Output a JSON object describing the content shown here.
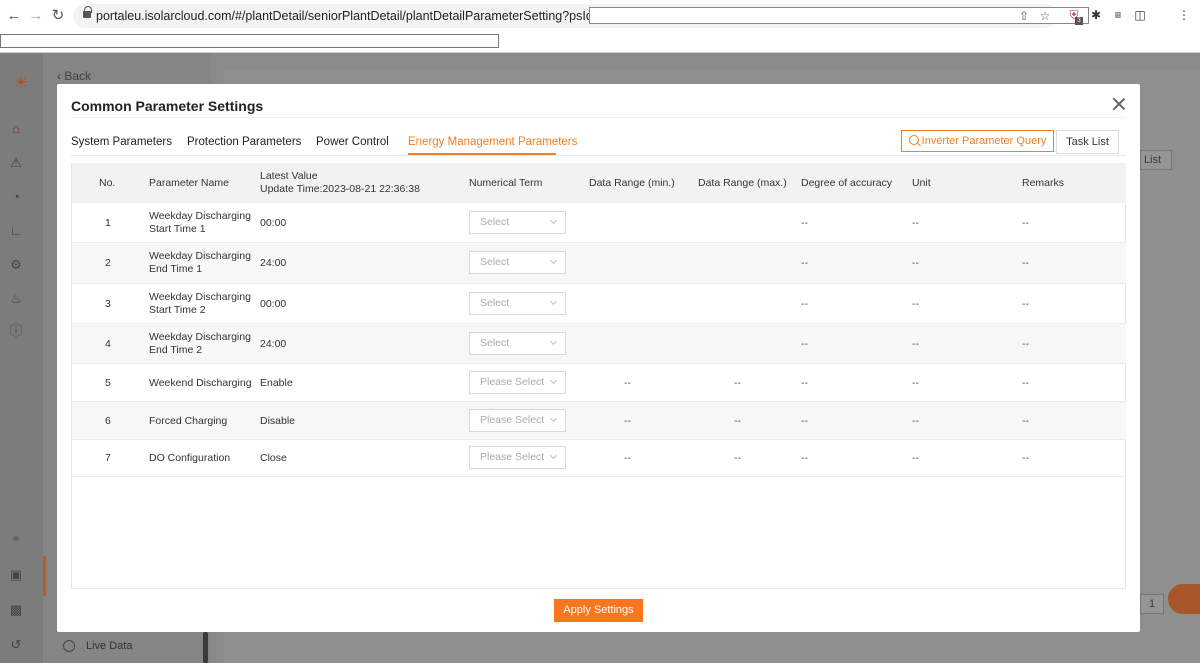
{
  "browser": {
    "url": "portaleu.isolarcloud.com/#/plantDetail/seniorPlantDetail/plantDetailParameterSetting?psId=",
    "ext_badge": "3"
  },
  "app": {
    "back_label": "Back",
    "live_data_label": "Live Data",
    "bg_list_label": "List",
    "bg_page_number": "1"
  },
  "modal": {
    "title": "Common Parameter Settings",
    "tabs": [
      {
        "label": "System Parameters"
      },
      {
        "label": "Protection Parameters"
      },
      {
        "label": "Power Control"
      },
      {
        "label": "Energy Management Parameters",
        "active": true
      }
    ],
    "query_button": "Inverter Parameter Query",
    "task_list_button": "Task List",
    "apply_button": "Apply Settings"
  },
  "table": {
    "headers": {
      "no": "No.",
      "name": "Parameter Name",
      "latest_value_1": "Latest Value",
      "latest_value_2": "Update Time:2023-08-21 22:36:38",
      "numerical_term": "Numerical Term",
      "range_min": "Data Range (min.)",
      "range_max": "Data Range (max.)",
      "accuracy": "Degree of accuracy",
      "unit": "Unit",
      "remarks": "Remarks"
    },
    "rows": [
      {
        "no": "1",
        "name_1": "Weekday Discharging",
        "name_2": "Start Time 1",
        "value": "00:00",
        "select": "Select",
        "min": "",
        "max": "",
        "accuracy": "--",
        "unit": "--",
        "remarks": "--"
      },
      {
        "no": "2",
        "name_1": "Weekday Discharging",
        "name_2": "End Time 1",
        "value": "24:00",
        "select": "Select",
        "min": "",
        "max": "",
        "accuracy": "--",
        "unit": "--",
        "remarks": "--"
      },
      {
        "no": "3",
        "name_1": "Weekday Discharging",
        "name_2": "Start Time 2",
        "value": "00:00",
        "select": "Select",
        "min": "",
        "max": "",
        "accuracy": "--",
        "unit": "--",
        "remarks": "--"
      },
      {
        "no": "4",
        "name_1": "Weekday Discharging",
        "name_2": "End Time 2",
        "value": "24:00",
        "select": "Select",
        "min": "",
        "max": "",
        "accuracy": "--",
        "unit": "--",
        "remarks": "--"
      },
      {
        "no": "5",
        "name_1": "Weekend Discharging",
        "name_2": "",
        "value": "Enable",
        "select": "Please Select",
        "min": "--",
        "max": "--",
        "accuracy": "--",
        "unit": "--",
        "remarks": "--"
      },
      {
        "no": "6",
        "name_1": "Forced Charging",
        "name_2": "",
        "value": "Disable",
        "select": "Please Select",
        "min": "--",
        "max": "--",
        "accuracy": "--",
        "unit": "--",
        "remarks": "--"
      },
      {
        "no": "7",
        "name_1": "DO Configuration",
        "name_2": "",
        "value": "Close",
        "select": "Please Select",
        "min": "--",
        "max": "--",
        "accuracy": "--",
        "unit": "--",
        "remarks": "--"
      }
    ]
  },
  "colors": {
    "accent": "#f27f23",
    "apply_button": "#f7761f"
  }
}
